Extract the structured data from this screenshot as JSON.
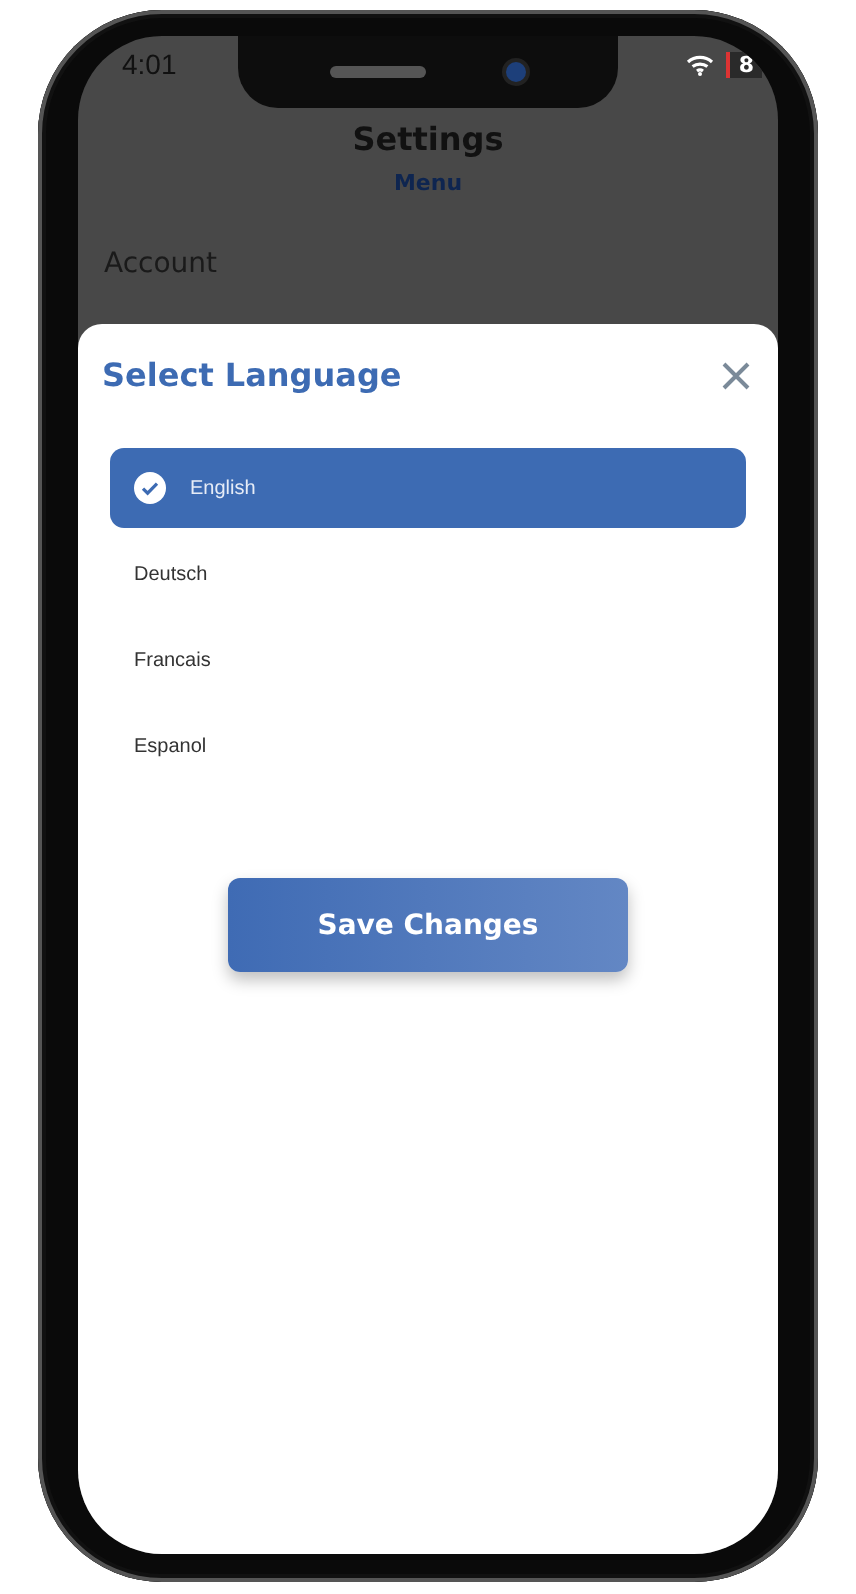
{
  "status_bar": {
    "time": "4:01",
    "battery": "8"
  },
  "header": {
    "title": "Settings",
    "subtitle": "Menu"
  },
  "section": {
    "title": "Account"
  },
  "language_sheet": {
    "title": "Select Language",
    "options": [
      {
        "label": "English",
        "selected": true
      },
      {
        "label": "Deutsch",
        "selected": false
      },
      {
        "label": "Francais",
        "selected": false
      },
      {
        "label": "Espanol",
        "selected": false
      }
    ],
    "save_button": "Save Changes"
  }
}
